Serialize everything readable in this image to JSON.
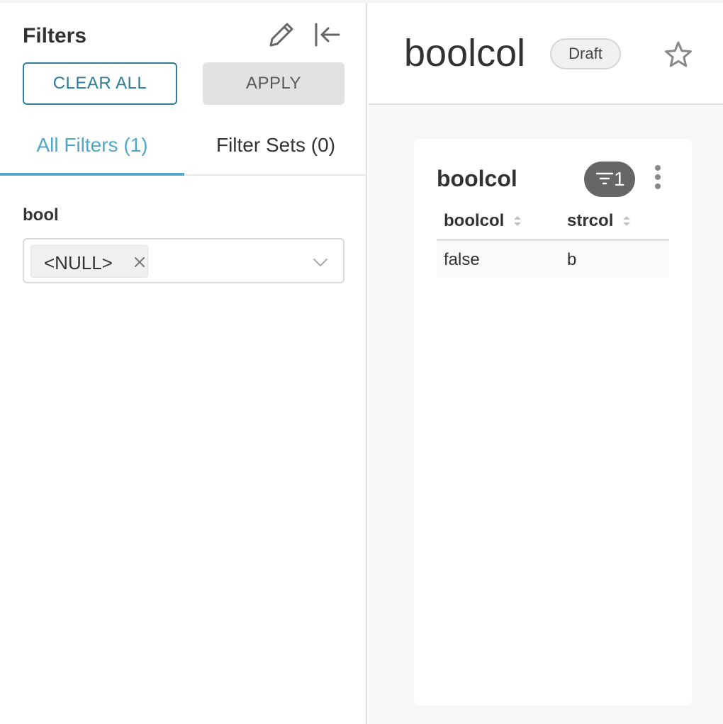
{
  "filter_panel": {
    "title": "Filters",
    "clear_all_label": "CLEAR ALL",
    "apply_label": "APPLY",
    "tabs": [
      {
        "label": "All Filters (1)",
        "active": true
      },
      {
        "label": "Filter Sets (0)",
        "active": false
      }
    ],
    "filters": [
      {
        "label": "bool",
        "selected_tag": "<NULL>"
      }
    ]
  },
  "dashboard": {
    "title": "boolcol",
    "status_badge": "Draft",
    "chart": {
      "title": "boolcol",
      "applied_filter_count": "1",
      "columns": [
        "boolcol",
        "strcol"
      ],
      "rows": [
        [
          "false",
          "b"
        ]
      ]
    }
  },
  "colors": {
    "accent": "#52a6c8",
    "clear_border": "#2f7d9a",
    "badge_bg": "#666666",
    "dashboard_bg": "#f7f7f7"
  },
  "icons": [
    "pencil-icon",
    "collapse-left-icon",
    "close-icon",
    "chevron-down-icon",
    "star-icon",
    "filter-icon",
    "more-vertical-icon",
    "sort-icon"
  ]
}
